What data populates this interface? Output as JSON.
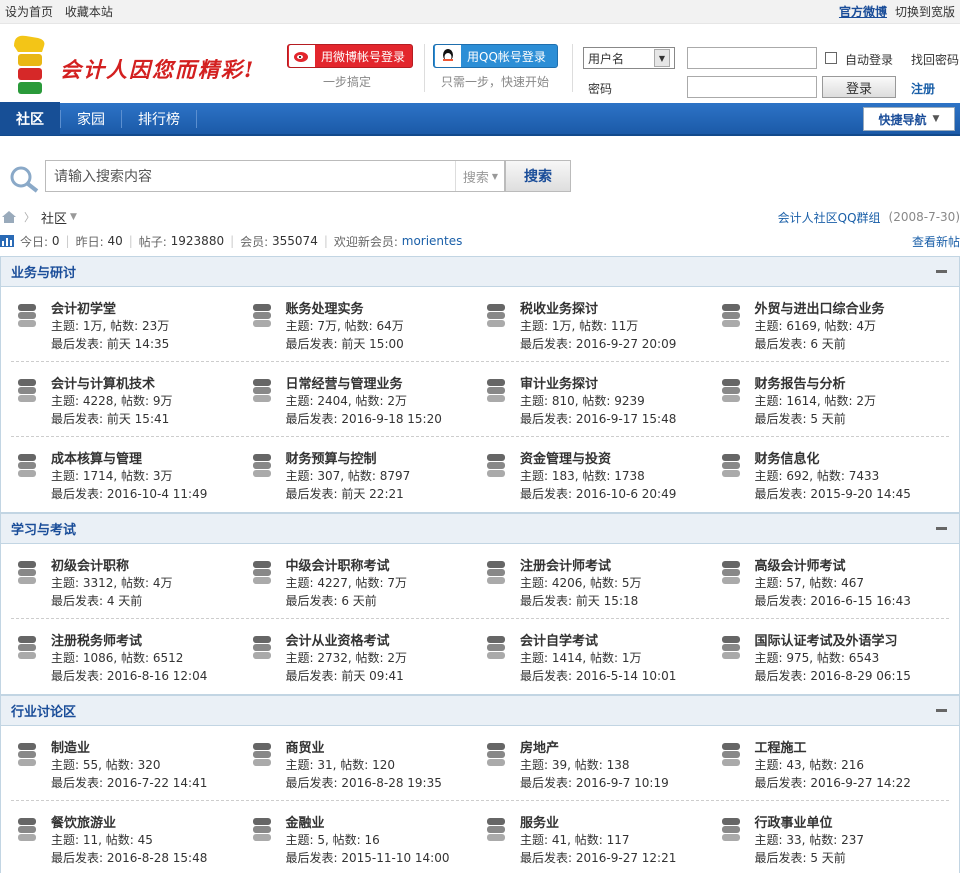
{
  "topbar": {
    "set_home": "设为首页",
    "bookmark": "收藏本站",
    "weibo": "官方微博",
    "wide": "切换到宽版"
  },
  "header": {
    "slogan": "会计人因您而精彩!",
    "weibo_login": "用微博帐号登录",
    "weibo_sub": "一步搞定",
    "qq_login": "用QQ帐号登录",
    "qq_sub": "只需一步，快速开始",
    "username_option": "用户名",
    "password_label": "密码",
    "auto_login": "自动登录",
    "login_button": "登录",
    "find_password": "找回密码",
    "register": "注册"
  },
  "nav": {
    "items": [
      "社区",
      "家园",
      "排行榜"
    ],
    "quick": "快捷导航"
  },
  "search": {
    "placeholder": "请输入搜索内容",
    "type": "搜索",
    "button": "搜索"
  },
  "crumb": {
    "current": "社区",
    "qq_group": "会计人社区QQ群组",
    "date": "(2008-7-30)"
  },
  "stats": {
    "today_label": "今日:",
    "today": "0",
    "yesterday_label": "昨日:",
    "yesterday": "40",
    "posts_label": "帖子:",
    "posts": "1923880",
    "members_label": "会员:",
    "members": "355074",
    "welcome": "欢迎新会员:",
    "new_member": "morientes",
    "view_new": "查看新帖"
  },
  "categories": [
    {
      "title": "业务与研讨",
      "rows": [
        [
          {
            "name": "会计初学堂",
            "stat": "主题: 1万, 帖数: 23万",
            "last": "最后发表: 前天 14:35"
          },
          {
            "name": "账务处理实务",
            "stat": "主题: 7万, 帖数: 64万",
            "last": "最后发表: 前天 15:00"
          },
          {
            "name": "税收业务探讨",
            "stat": "主题: 1万, 帖数: 11万",
            "last": "最后发表: 2016-9-27 20:09"
          },
          {
            "name": "外贸与进出口综合业务",
            "stat": "主题: 6169, 帖数: 4万",
            "last": "最后发表: 6 天前"
          }
        ],
        [
          {
            "name": "会计与计算机技术",
            "stat": "主题: 4228, 帖数: 9万",
            "last": "最后发表: 前天 15:41"
          },
          {
            "name": "日常经营与管理业务",
            "stat": "主题: 2404, 帖数: 2万",
            "last": "最后发表: 2016-9-18 15:20"
          },
          {
            "name": "审计业务探讨",
            "stat": "主题: 810, 帖数: 9239",
            "last": "最后发表: 2016-9-17 15:48"
          },
          {
            "name": "财务报告与分析",
            "stat": "主题: 1614, 帖数: 2万",
            "last": "最后发表: 5 天前"
          }
        ],
        [
          {
            "name": "成本核算与管理",
            "stat": "主题: 1714, 帖数: 3万",
            "last": "最后发表: 2016-10-4 11:49"
          },
          {
            "name": "财务预算与控制",
            "stat": "主题: 307, 帖数: 8797",
            "last": "最后发表: 前天 22:21"
          },
          {
            "name": "资金管理与投资",
            "stat": "主题: 183, 帖数: 1738",
            "last": "最后发表: 2016-10-6 20:49"
          },
          {
            "name": "财务信息化",
            "stat": "主题: 692, 帖数: 7433",
            "last": "最后发表: 2015-9-20 14:45"
          }
        ]
      ]
    },
    {
      "title": "学习与考试",
      "rows": [
        [
          {
            "name": "初级会计职称",
            "stat": "主题: 3312, 帖数: 4万",
            "last": "最后发表: 4 天前"
          },
          {
            "name": "中级会计职称考试",
            "stat": "主题: 4227, 帖数: 7万",
            "last": "最后发表: 6 天前"
          },
          {
            "name": "注册会计师考试",
            "stat": "主题: 4206, 帖数: 5万",
            "last": "最后发表: 前天 15:18"
          },
          {
            "name": "高级会计师考试",
            "stat": "主题: 57, 帖数: 467",
            "last": "最后发表: 2016-6-15 16:43"
          }
        ],
        [
          {
            "name": "注册税务师考试",
            "stat": "主题: 1086, 帖数: 6512",
            "last": "最后发表: 2016-8-16 12:04"
          },
          {
            "name": "会计从业资格考试",
            "stat": "主题: 2732, 帖数: 2万",
            "last": "最后发表: 前天 09:41"
          },
          {
            "name": "会计自学考试",
            "stat": "主题: 1414, 帖数: 1万",
            "last": "最后发表: 2016-5-14 10:01"
          },
          {
            "name": "国际认证考试及外语学习",
            "stat": "主题: 975, 帖数: 6543",
            "last": "最后发表: 2016-8-29 06:15"
          }
        ]
      ]
    },
    {
      "title": "行业讨论区",
      "rows": [
        [
          {
            "name": "制造业",
            "stat": "主题: 55, 帖数: 320",
            "last": "最后发表: 2016-7-22 14:41"
          },
          {
            "name": "商贸业",
            "stat": "主题: 31, 帖数: 120",
            "last": "最后发表: 2016-8-28 19:35"
          },
          {
            "name": "房地产",
            "stat": "主题: 39, 帖数: 138",
            "last": "最后发表: 2016-9-7 10:19"
          },
          {
            "name": "工程施工",
            "stat": "主题: 43, 帖数: 216",
            "last": "最后发表: 2016-9-27 14:22"
          }
        ],
        [
          {
            "name": "餐饮旅游业",
            "stat": "主题: 11, 帖数: 45",
            "last": "最后发表: 2016-8-28 15:48"
          },
          {
            "name": "金融业",
            "stat": "主题: 5, 帖数: 16",
            "last": "最后发表: 2015-11-10 14:00"
          },
          {
            "name": "服务业",
            "stat": "主题: 41, 帖数: 117",
            "last": "最后发表: 2016-9-27 12:21"
          },
          {
            "name": "行政事业单位",
            "stat": "主题: 33, 帖数: 237",
            "last": "最后发表: 5 天前"
          }
        ]
      ]
    }
  ]
}
